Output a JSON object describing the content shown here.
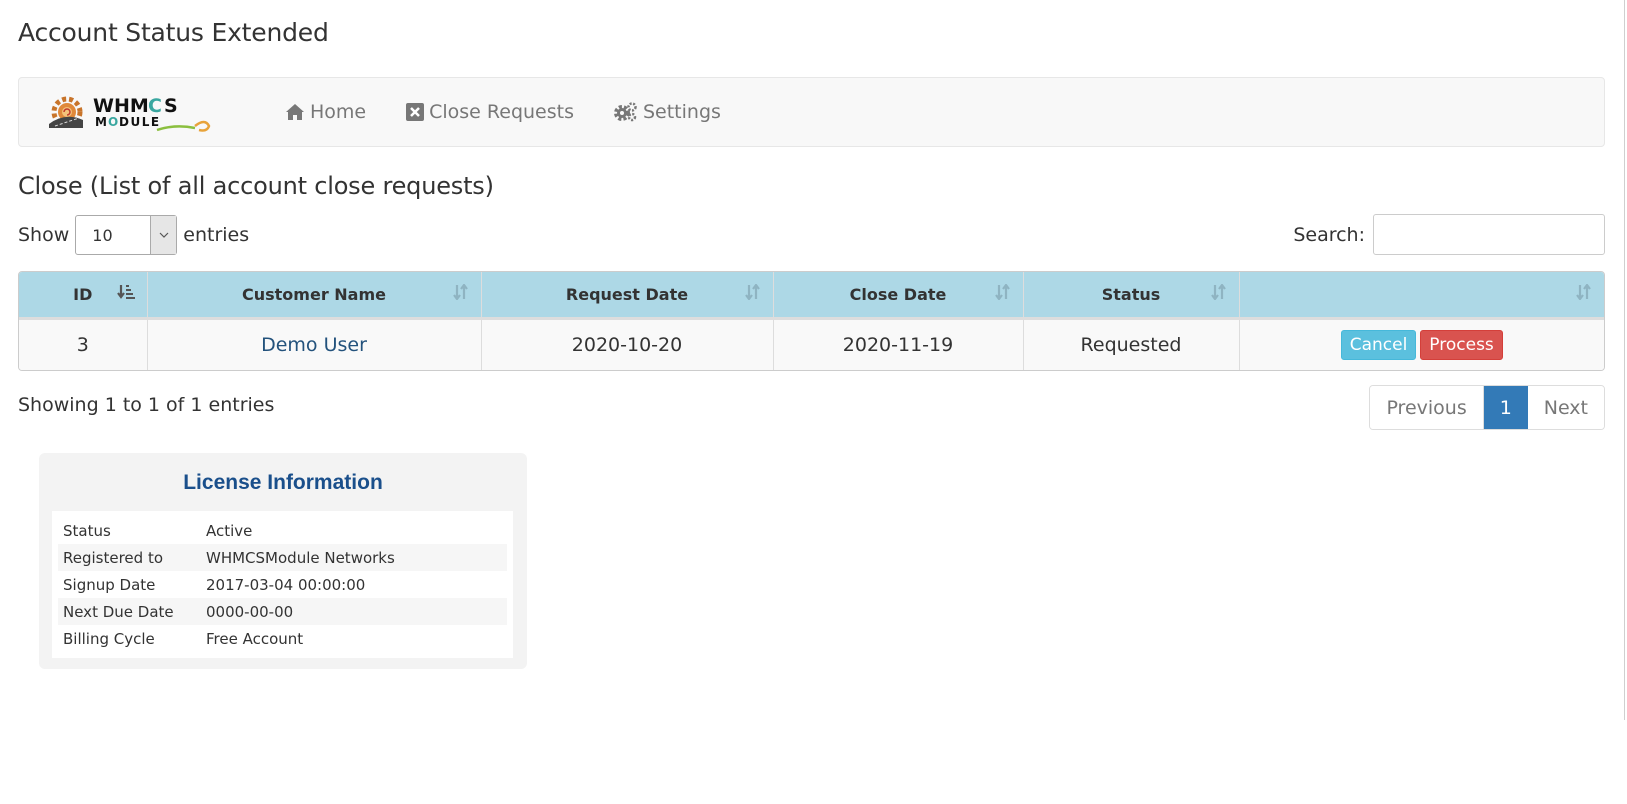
{
  "page": {
    "title": "Account Status Extended"
  },
  "navbar": {
    "logo_alt": "WHMCS MODULE",
    "items": [
      {
        "label": "Home",
        "icon": "home-icon"
      },
      {
        "label": "Close Requests",
        "icon": "close-square-icon"
      },
      {
        "label": "Settings",
        "icon": "gears-icon"
      }
    ]
  },
  "section": {
    "title": "Close (List of all account close requests)"
  },
  "length_control": {
    "prefix": "Show",
    "selected": "10",
    "suffix": "entries"
  },
  "search": {
    "label": "Search:",
    "value": "",
    "placeholder": ""
  },
  "table": {
    "columns": [
      "ID",
      "Customer Name",
      "Request Date",
      "Close Date",
      "Status",
      ""
    ],
    "rows": [
      {
        "id": "3",
        "customer": "Demo User",
        "request_date": "2020-10-20",
        "close_date": "2020-11-19",
        "status": "Requested",
        "actions": [
          "Cancel",
          "Process"
        ]
      }
    ]
  },
  "info": {
    "text": "Showing 1 to 1 of 1 entries"
  },
  "pagination": {
    "previous": "Previous",
    "current": "1",
    "next": "Next"
  },
  "license": {
    "title": "License Information",
    "rows": [
      {
        "label": "Status",
        "value": "Active"
      },
      {
        "label": "Registered to",
        "value": "WHMCSModule Networks"
      },
      {
        "label": "Signup Date",
        "value": "2017-03-04 00:00:00"
      },
      {
        "label": "Next Due Date",
        "value": "0000-00-00"
      },
      {
        "label": "Billing Cycle",
        "value": "Free Account"
      }
    ]
  },
  "colors": {
    "table_header": "#add8e6",
    "info_button": "#5bc0de",
    "danger_button": "#d9534f",
    "active_page": "#337ab7",
    "license_title": "#1a4f8b"
  }
}
